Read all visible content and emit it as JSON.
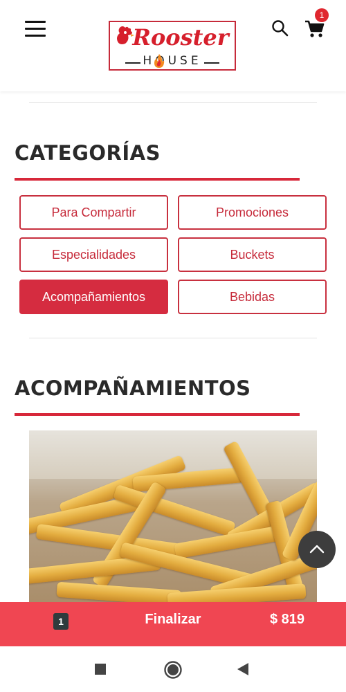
{
  "header": {
    "logo": {
      "word": "Rooster",
      "sub": "HOUSE"
    },
    "cart_count": "1",
    "icons": {
      "menu": "hamburger-menu-icon",
      "search": "search-icon",
      "cart": "shopping-cart-icon"
    }
  },
  "categories": {
    "title": "CATEGORÍAS",
    "items": [
      {
        "label": "Para Compartir",
        "active": false
      },
      {
        "label": "Promociones",
        "active": false
      },
      {
        "label": "Especialidades",
        "active": false
      },
      {
        "label": "Buckets",
        "active": false
      },
      {
        "label": "Acompañamientos",
        "active": true
      },
      {
        "label": "Bebidas",
        "active": false
      }
    ]
  },
  "section": {
    "title": "ACOMPAÑAMIENTOS",
    "image": "french-fries-photo"
  },
  "bottom_bar": {
    "count": "1",
    "action": "Finalizar",
    "total": "$ 819"
  },
  "colors": {
    "brand_red": "#d7283a",
    "bar_red": "#f04652",
    "active_bg": "#d52c40"
  },
  "system_nav": {
    "icons": [
      "square-recents-icon",
      "circle-home-icon",
      "triangle-back-icon"
    ]
  }
}
